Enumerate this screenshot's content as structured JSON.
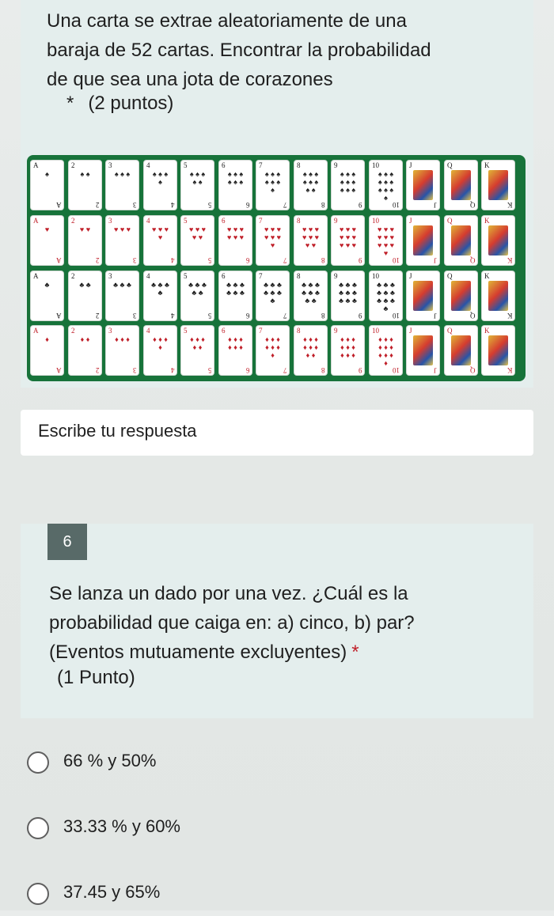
{
  "question1": {
    "lines": [
      "Una carta se extrae aleatoriamente de una",
      "baraja de 52 cartas. Encontrar la probabilidad",
      "de que sea una jota de corazones"
    ],
    "asterisk": "*",
    "points": "(2 puntos)"
  },
  "cards": {
    "ranks": [
      "A",
      "2",
      "3",
      "4",
      "5",
      "6",
      "7",
      "8",
      "9",
      "10",
      "J",
      "Q",
      "K"
    ],
    "rows": [
      {
        "suit": "♠",
        "color": "black"
      },
      {
        "suit": "♥",
        "color": "red"
      },
      {
        "suit": "♣",
        "color": "black"
      },
      {
        "suit": "♦",
        "color": "red"
      }
    ]
  },
  "answer_placeholder": "Escribe tu respuesta",
  "question2": {
    "number": "6",
    "lines": [
      "Se lanza un dado por una vez. ¿Cuál es la",
      "probabilidad que caiga en: a) cinco, b) par?",
      "(Eventos mutuamente excluyentes)"
    ],
    "required": "*",
    "points": "(1 Punto)"
  },
  "options": [
    {
      "label": "66 % y 50%"
    },
    {
      "label": "33.33 % y 60%"
    },
    {
      "label": "37.45 y 65%"
    }
  ]
}
